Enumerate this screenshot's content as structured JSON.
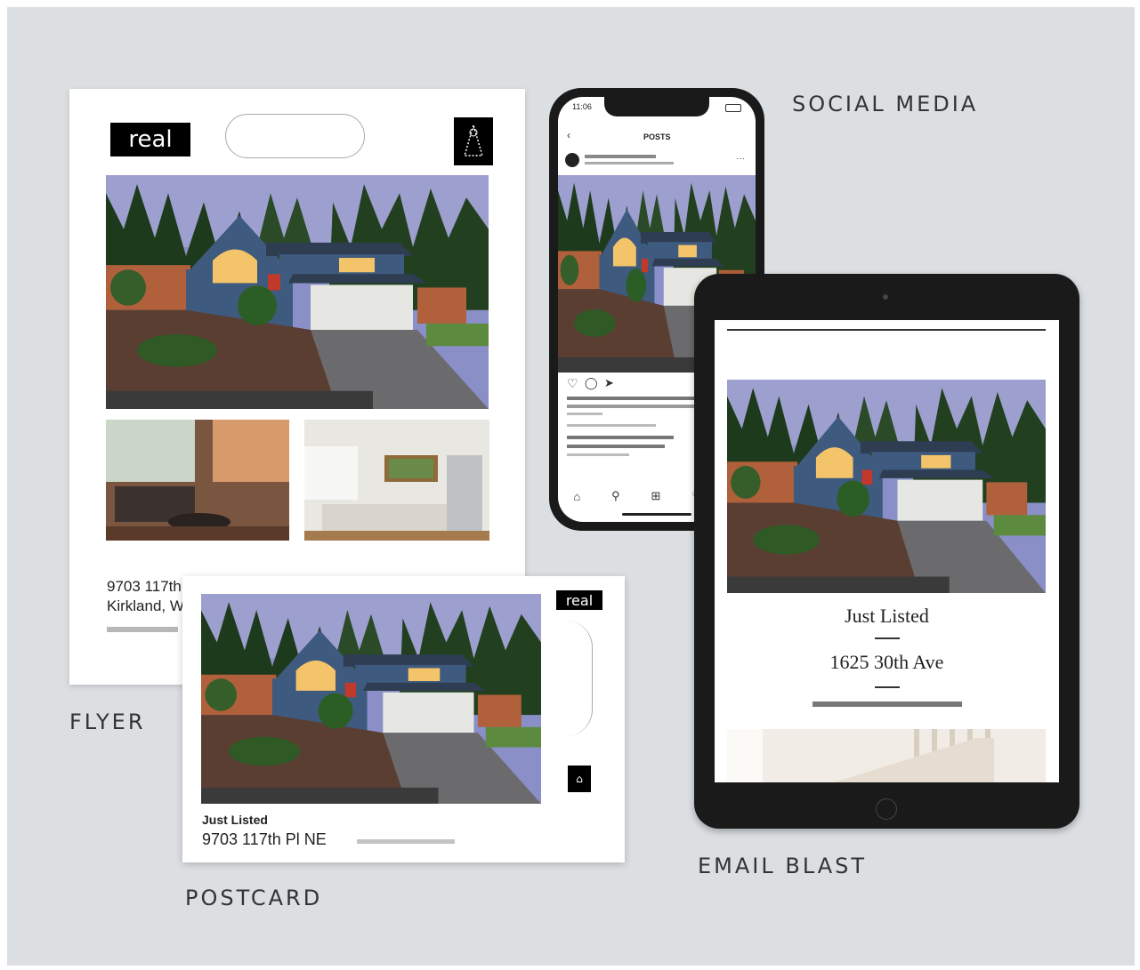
{
  "captions": {
    "flyer": "FLYER",
    "postcard": "POSTCARD",
    "social_media": "SOCIAL MEDIA",
    "email_blast": "EMAIL BLAST"
  },
  "flyer": {
    "logo_text": "real",
    "address_line1": "9703 117th",
    "address_line2": "Kirkland, W"
  },
  "postcard": {
    "logo_text": "real",
    "heading": "Just Listed",
    "address": "9703 117th Pl NE"
  },
  "email": {
    "heading": "Just Listed",
    "address": "1625 30th Ave"
  },
  "phone": {
    "time": "11:06",
    "header_title": "POSTS"
  },
  "colors": {
    "background": "#dcdfe2",
    "device_frame": "#1a1a1a",
    "house_siding": "#3e5a7e",
    "sky": "#8a8fc7"
  },
  "icons": [
    "heart-icon",
    "comment-icon",
    "share-icon",
    "bookmark-icon",
    "home-icon",
    "search-icon",
    "add-post-icon",
    "activity-icon",
    "profile-icon"
  ]
}
